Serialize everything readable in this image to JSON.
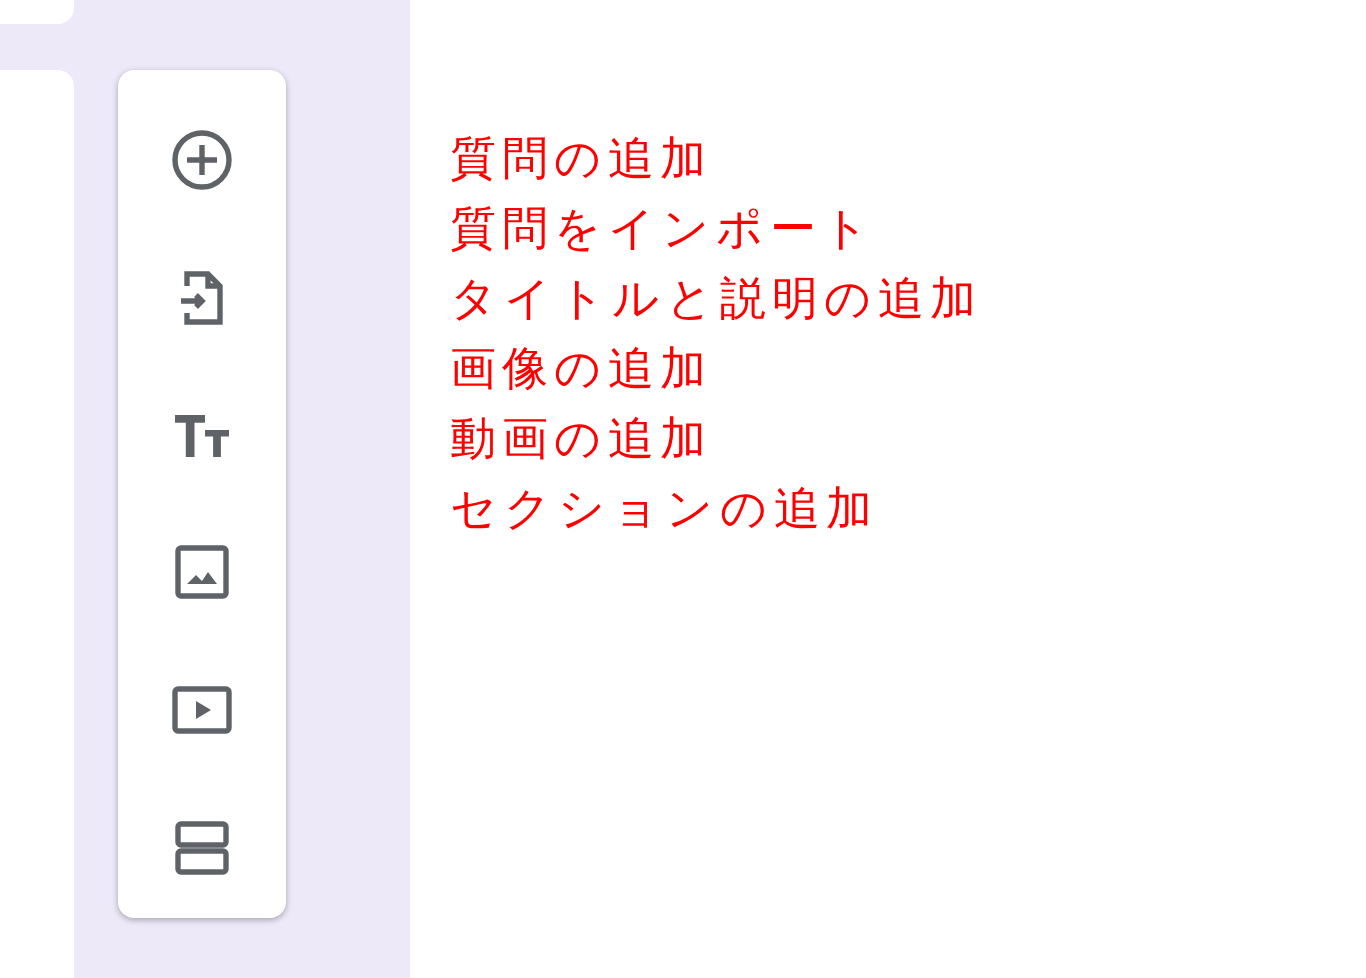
{
  "toolbar": [
    {
      "kind": "add-question"
    },
    {
      "kind": "import"
    },
    {
      "kind": "title"
    },
    {
      "kind": "image"
    },
    {
      "kind": "video"
    },
    {
      "kind": "section"
    }
  ],
  "labels": [
    "質問の追加",
    "質問をインポート",
    "タイトルと説明の追加",
    "画像の追加",
    "動画の追加",
    "セクションの追加"
  ]
}
